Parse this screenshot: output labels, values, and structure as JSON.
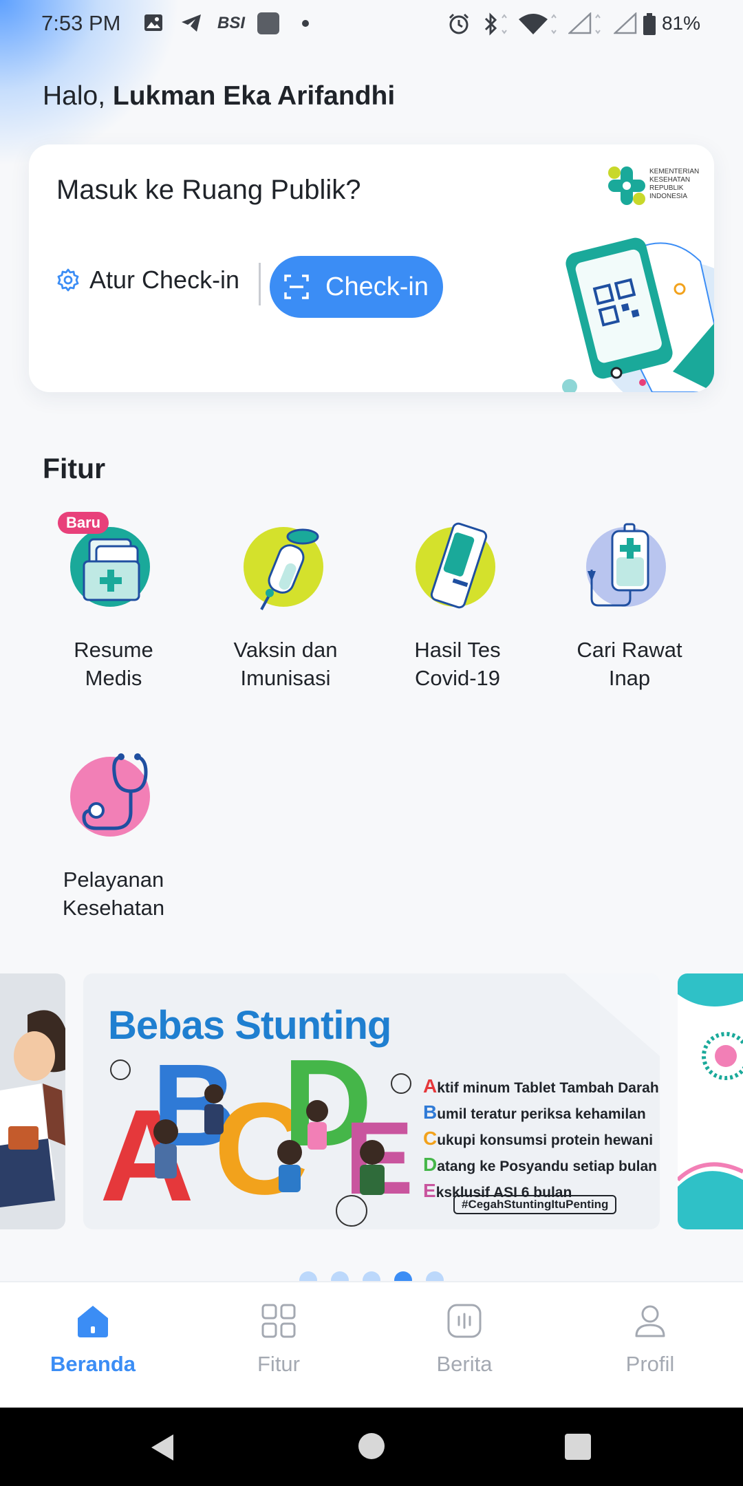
{
  "status_bar": {
    "time": "7:53 PM",
    "network_label": "BSI",
    "battery": "81%",
    "icons": [
      "gallery-icon",
      "telegram-icon",
      "bsi-icon",
      "app-icon",
      "dot-icon",
      "alarm-icon",
      "bluetooth-icon",
      "wifi-icon",
      "signal-icon",
      "signal-icon",
      "battery-icon"
    ]
  },
  "greeting": {
    "prefix": "Halo, ",
    "name": "Lukman Eka Arifandhi"
  },
  "checkin_card": {
    "title": "Masuk ke Ruang Publik?",
    "ministry_text": "KEMENTERIAN KESEHATAN REPUBLIK INDONESIA",
    "settings_label": "Atur Check-in",
    "checkin_label": "Check-in"
  },
  "features": {
    "title": "Fitur",
    "items": [
      {
        "label_line1": "Resume",
        "label_line2": "Medis",
        "badge": "Baru",
        "icon": "medical-folder-icon"
      },
      {
        "label_line1": "Vaksin dan",
        "label_line2": "Imunisasi",
        "icon": "vaccine-icon"
      },
      {
        "label_line1": "Hasil Tes",
        "label_line2": "Covid-19",
        "icon": "test-kit-icon"
      },
      {
        "label_line1": "Cari Rawat",
        "label_line2": "Inap",
        "icon": "iv-bag-icon"
      },
      {
        "label_line1": "Pelayanan",
        "label_line2": "Kesehatan",
        "icon": "stethoscope-icon"
      }
    ]
  },
  "banner": {
    "title": "Bebas Stunting",
    "list": [
      {
        "cap": "A",
        "rest": "ktif minum Tablet Tambah Darah",
        "color": "#e5383b"
      },
      {
        "cap": "B",
        "rest": "umil teratur periksa kehamilan",
        "color": "#2f7ad6"
      },
      {
        "cap": "C",
        "rest": "ukupi konsumsi protein hewani",
        "color": "#f2a21c"
      },
      {
        "cap": "D",
        "rest": "atang ke Posyandu setiap bulan",
        "color": "#45b649"
      },
      {
        "cap": "E",
        "rest": "ksklusif ASI 6 bulan",
        "color": "#c9559e"
      }
    ],
    "hashtag": "#CegahStuntingItuPenting",
    "carousel_total": 5,
    "carousel_active": 4
  },
  "bottom_nav": {
    "items": [
      {
        "label": "Beranda",
        "icon": "home-icon",
        "active": true
      },
      {
        "label": "Fitur",
        "icon": "grid-icon",
        "active": false
      },
      {
        "label": "Berita",
        "icon": "news-icon",
        "active": false
      },
      {
        "label": "Profil",
        "icon": "profile-icon",
        "active": false
      }
    ]
  },
  "colors": {
    "accent": "#3b8df5",
    "badge": "#e8407a",
    "teal": "#1aa99a"
  }
}
